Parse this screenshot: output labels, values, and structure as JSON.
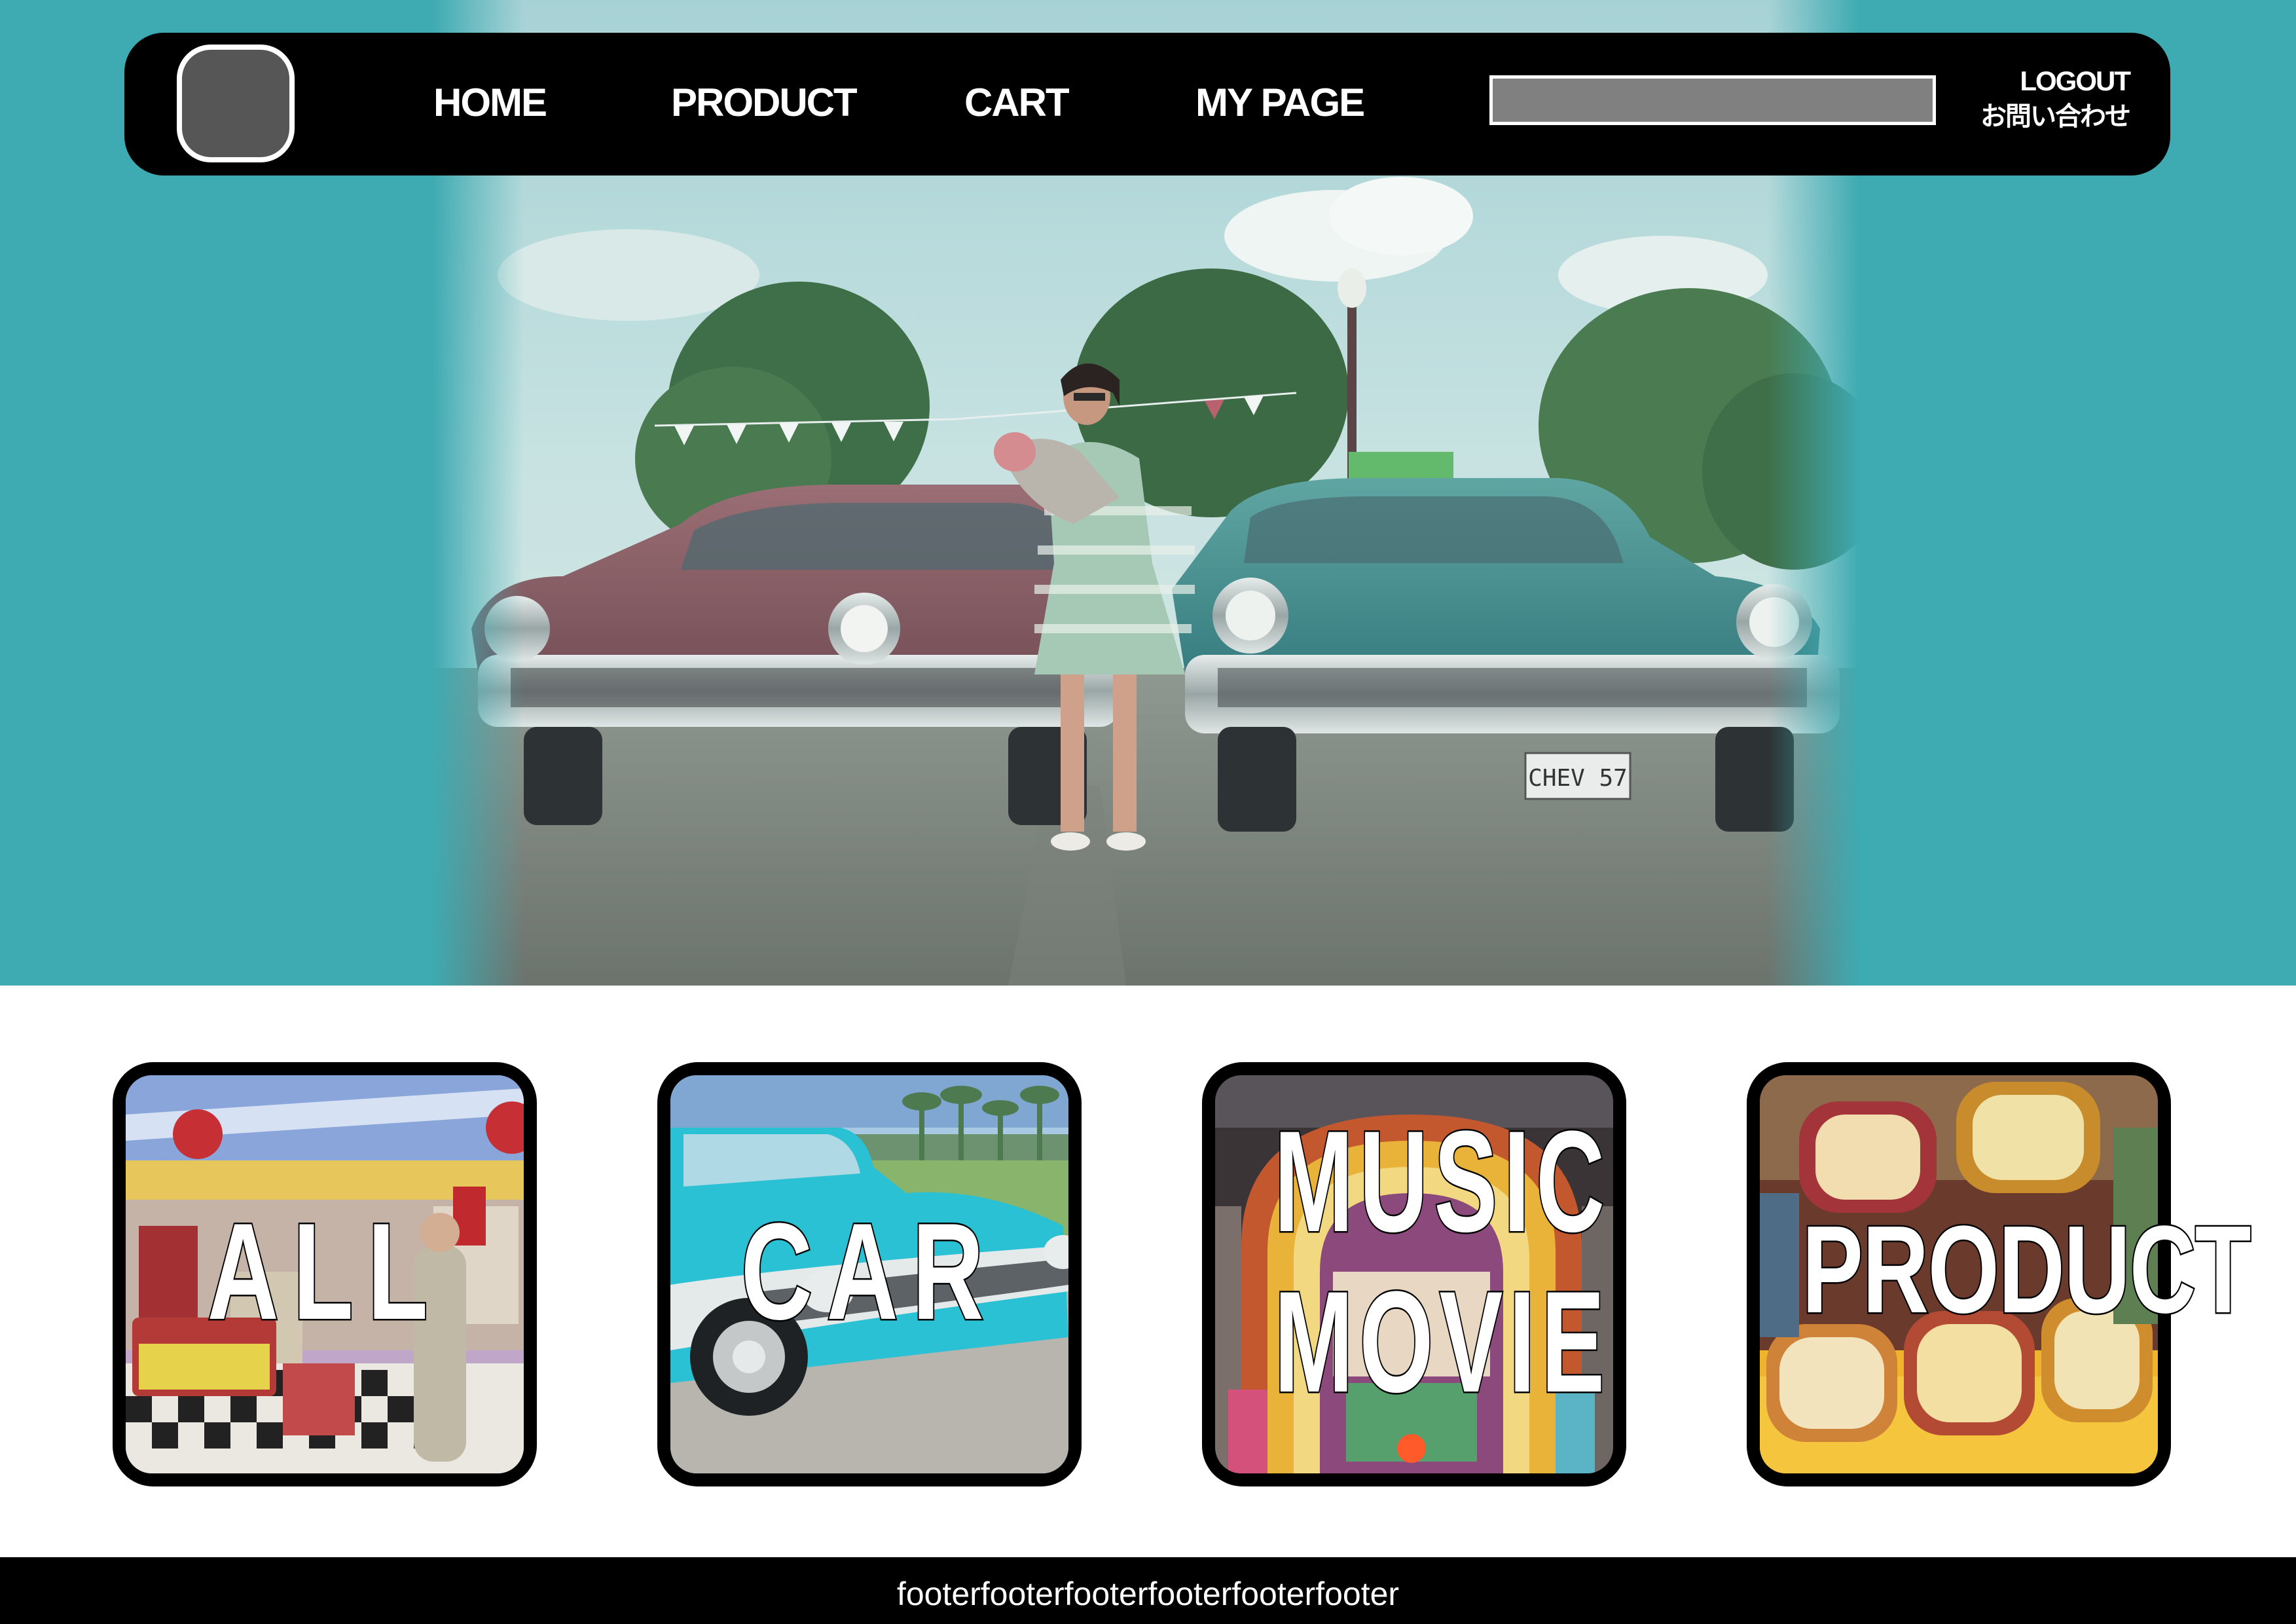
{
  "nav": {
    "items": [
      "HOME",
      "PRODUCT",
      "CART",
      "MY PAGE"
    ],
    "logout": "LOGOUT",
    "contact": "お問い合わせ",
    "search_value": ""
  },
  "hero": {
    "photo": "retro-car-show-woman-holding-baby",
    "plate_text": "CHEV 57"
  },
  "categories": [
    {
      "label": "ALL",
      "image": "retro-diner-interior"
    },
    {
      "label": "CAR",
      "image": "turquoise-vintage-car"
    },
    {
      "label_lines": [
        "MUSIC",
        "MOVIE"
      ],
      "image": "jukebox"
    },
    {
      "label": "PRODUCT",
      "image": "retro-clocks"
    }
  ],
  "footer": {
    "text": "footerfooterfooterfooterfooterfooter"
  },
  "colors": {
    "accent": "#3eabb2",
    "nav_bg": "#000000",
    "logo": "#565656",
    "search": "#808080"
  }
}
